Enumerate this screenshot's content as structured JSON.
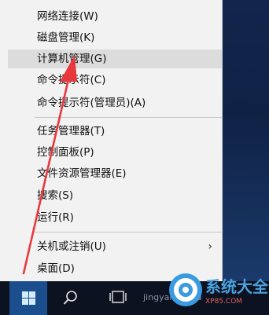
{
  "menu": {
    "items": [
      {
        "label": "网络连接(W)"
      },
      {
        "label": "磁盘管理(K)"
      },
      {
        "label": "计算机管理(G)"
      },
      {
        "label": "命令提示符(C)"
      },
      {
        "label": "命令提示符(管理员)(A)"
      },
      {
        "label": "任务管理器(T)"
      },
      {
        "label": "控制面板(P)"
      },
      {
        "label": "文件资源管理器(E)"
      },
      {
        "label": "搜索(S)"
      },
      {
        "label": "运行(R)"
      },
      {
        "label": "关机或注销(U)"
      },
      {
        "label": "桌面(D)"
      }
    ],
    "highlighted_item": "计算机管理(G)",
    "submenu_arrow": "›"
  },
  "taskbar": {
    "start_icon": "windows-logo-icon",
    "search_icon": "search-icon",
    "task_view_icon": "task-view-icon",
    "faint_text": "jingyan.baidu"
  },
  "watermark": {
    "brand": "系统大全",
    "url": "XP85.COM"
  },
  "colors": {
    "menu_bg": "#f2f2f2",
    "highlight": "#dcdcdc",
    "taskbar": "#0c1220",
    "start_button": "#1b4e8c",
    "arrow": "#e8383d"
  }
}
